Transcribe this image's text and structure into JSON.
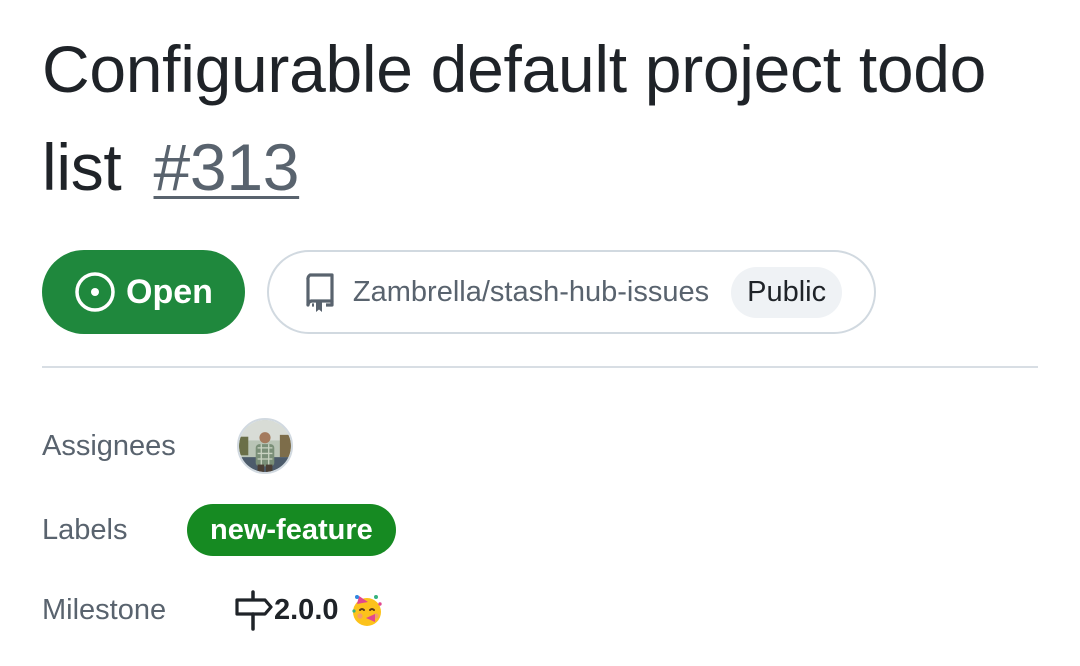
{
  "issue": {
    "title": "Configurable default project todo list",
    "number": "#313",
    "state": "Open",
    "state_icon": "issue-opened-icon",
    "repository": "Zambrella/stash-hub-issues",
    "repo_icon": "repo-icon",
    "visibility": "Public"
  },
  "sidebar": {
    "assignees_label": "Assignees",
    "labels_label": "Labels",
    "milestone_label": "Milestone",
    "labels": [
      {
        "name": "new-feature",
        "color": "#168a22"
      }
    ],
    "milestone": {
      "icon": "milestone-icon",
      "title": "2.0.0",
      "emoji": "partying-face"
    }
  },
  "colors": {
    "open_green": "#1f883d",
    "muted_text": "#59636e",
    "border": "#d1d9e0"
  }
}
